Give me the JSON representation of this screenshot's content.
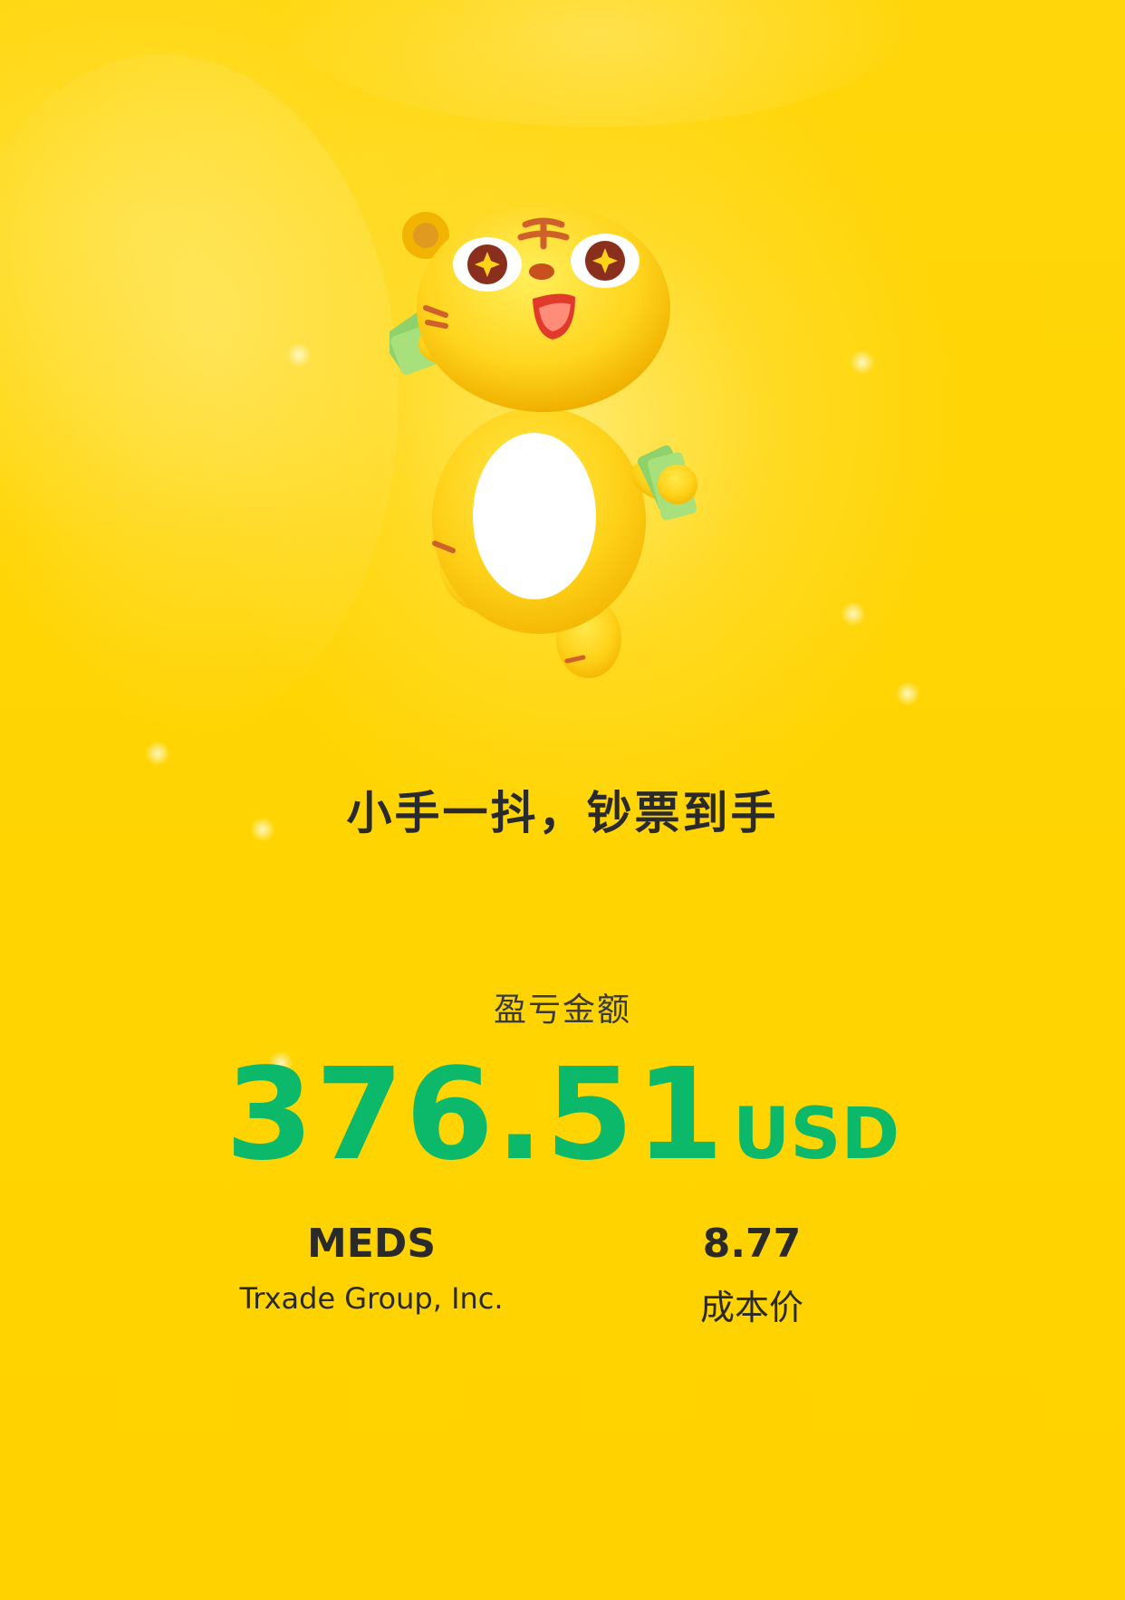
{
  "colors": {
    "background": "#FFD400",
    "profit_green": "#0CB86A",
    "text_dark": "#2A2A2A"
  },
  "mascot": {
    "icon": "tiger-mascot-holding-cash-icon"
  },
  "slogan": "小手一抖，钞票到手",
  "pnl": {
    "label": "盈亏金额",
    "value": "376.51",
    "currency": "USD"
  },
  "stock": {
    "symbol": "MEDS",
    "name": "Trxade Group, Inc."
  },
  "cost": {
    "value": "8.77",
    "label": "成本价"
  }
}
